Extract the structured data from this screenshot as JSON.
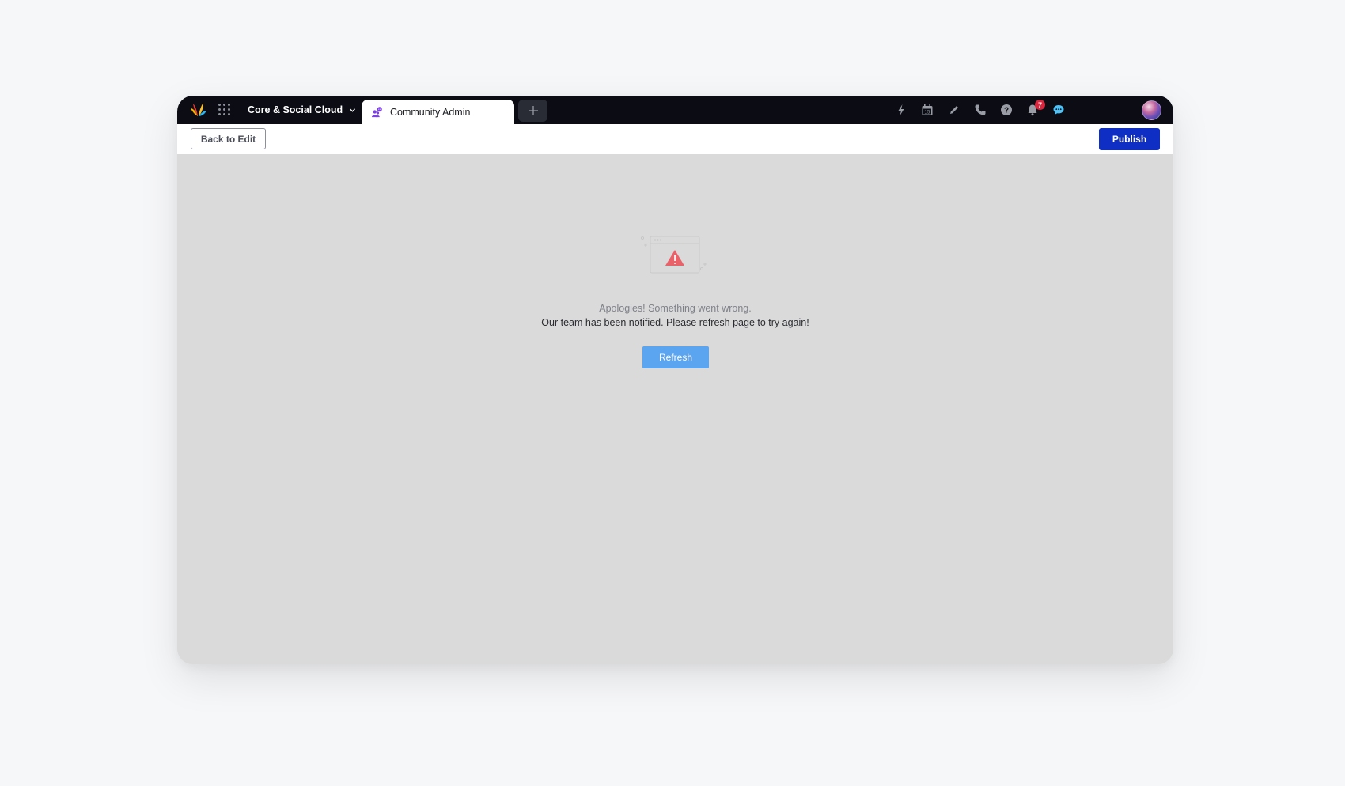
{
  "navbar": {
    "workspace_label": "Core & Social Cloud",
    "active_tab_label": "Community Admin",
    "icons": [
      {
        "name": "lightning-icon"
      },
      {
        "name": "calendar-icon",
        "day": "15"
      },
      {
        "name": "pencil-icon"
      },
      {
        "name": "phone-icon"
      },
      {
        "name": "help-icon"
      },
      {
        "name": "notification-bell-icon",
        "badge": "7"
      },
      {
        "name": "chat-icon"
      }
    ],
    "notification_count": "7",
    "calendar_day": "15"
  },
  "toolbar": {
    "back_label": "Back to Edit",
    "publish_label": "Publish"
  },
  "error": {
    "title": "Apologies! Something went wrong.",
    "message": "Our team has been notified. Please refresh page to try again!",
    "refresh_label": "Refresh"
  },
  "colors": {
    "navbar_bg": "#0b0c14",
    "publish_bg": "#0f2fc4",
    "refresh_bg": "#5ba4ef",
    "warning_red": "#e9626a",
    "badge_red": "#d7263d",
    "content_bg": "#dadada"
  }
}
